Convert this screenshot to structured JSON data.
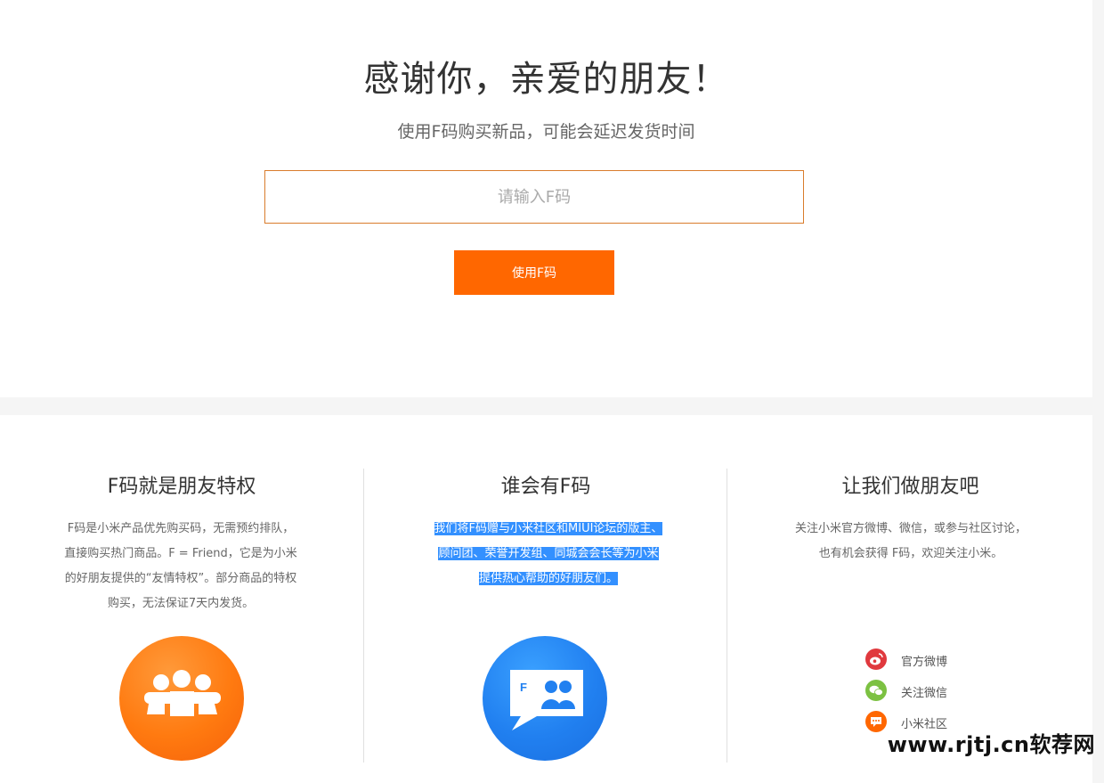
{
  "top": {
    "title": "感谢你，亲爱的朋友！",
    "subtitle": "使用F码购买新品，可能会延迟发货时间",
    "input_placeholder": "请输入F码",
    "input_value": "",
    "button_label": "使用F码"
  },
  "columns": [
    {
      "title": "F码就是朋友特权",
      "text": "F码是小米产品优先购买码，无需预约排队，直接购买热门商品。F = Friend，它是为小米的好朋友提供的“友情特权”。部分商品的特权购买，无法保证7天内发货。",
      "icon": "friends-group-icon",
      "icon_color": "#ff7a10"
    },
    {
      "title": "谁会有F码",
      "text": "我们将F码赠与小米社区和MIUI论坛的版主、顾问团、荣誉开发组、同城会会长等为小米提供热心帮助的好朋友们。",
      "icon": "fcode-chat-icon",
      "icon_color": "#2180f0"
    },
    {
      "title": "让我们做朋友吧",
      "text": "关注小米官方微博、微信，或参与社区讨论，也有机会获得 F码，欢迎关注小米。"
    }
  ],
  "social": [
    {
      "label": "官方微博",
      "icon": "weibo-icon",
      "color": "#e0393e"
    },
    {
      "label": "关注微信",
      "icon": "wechat-icon",
      "color": "#7cc142"
    },
    {
      "label": "小米社区",
      "icon": "community-icon",
      "color": "#ff6700"
    }
  ],
  "watermark": "www.rjtj.cn软荐网",
  "colors": {
    "accent": "#ff6700",
    "selection": "#3390ff"
  }
}
